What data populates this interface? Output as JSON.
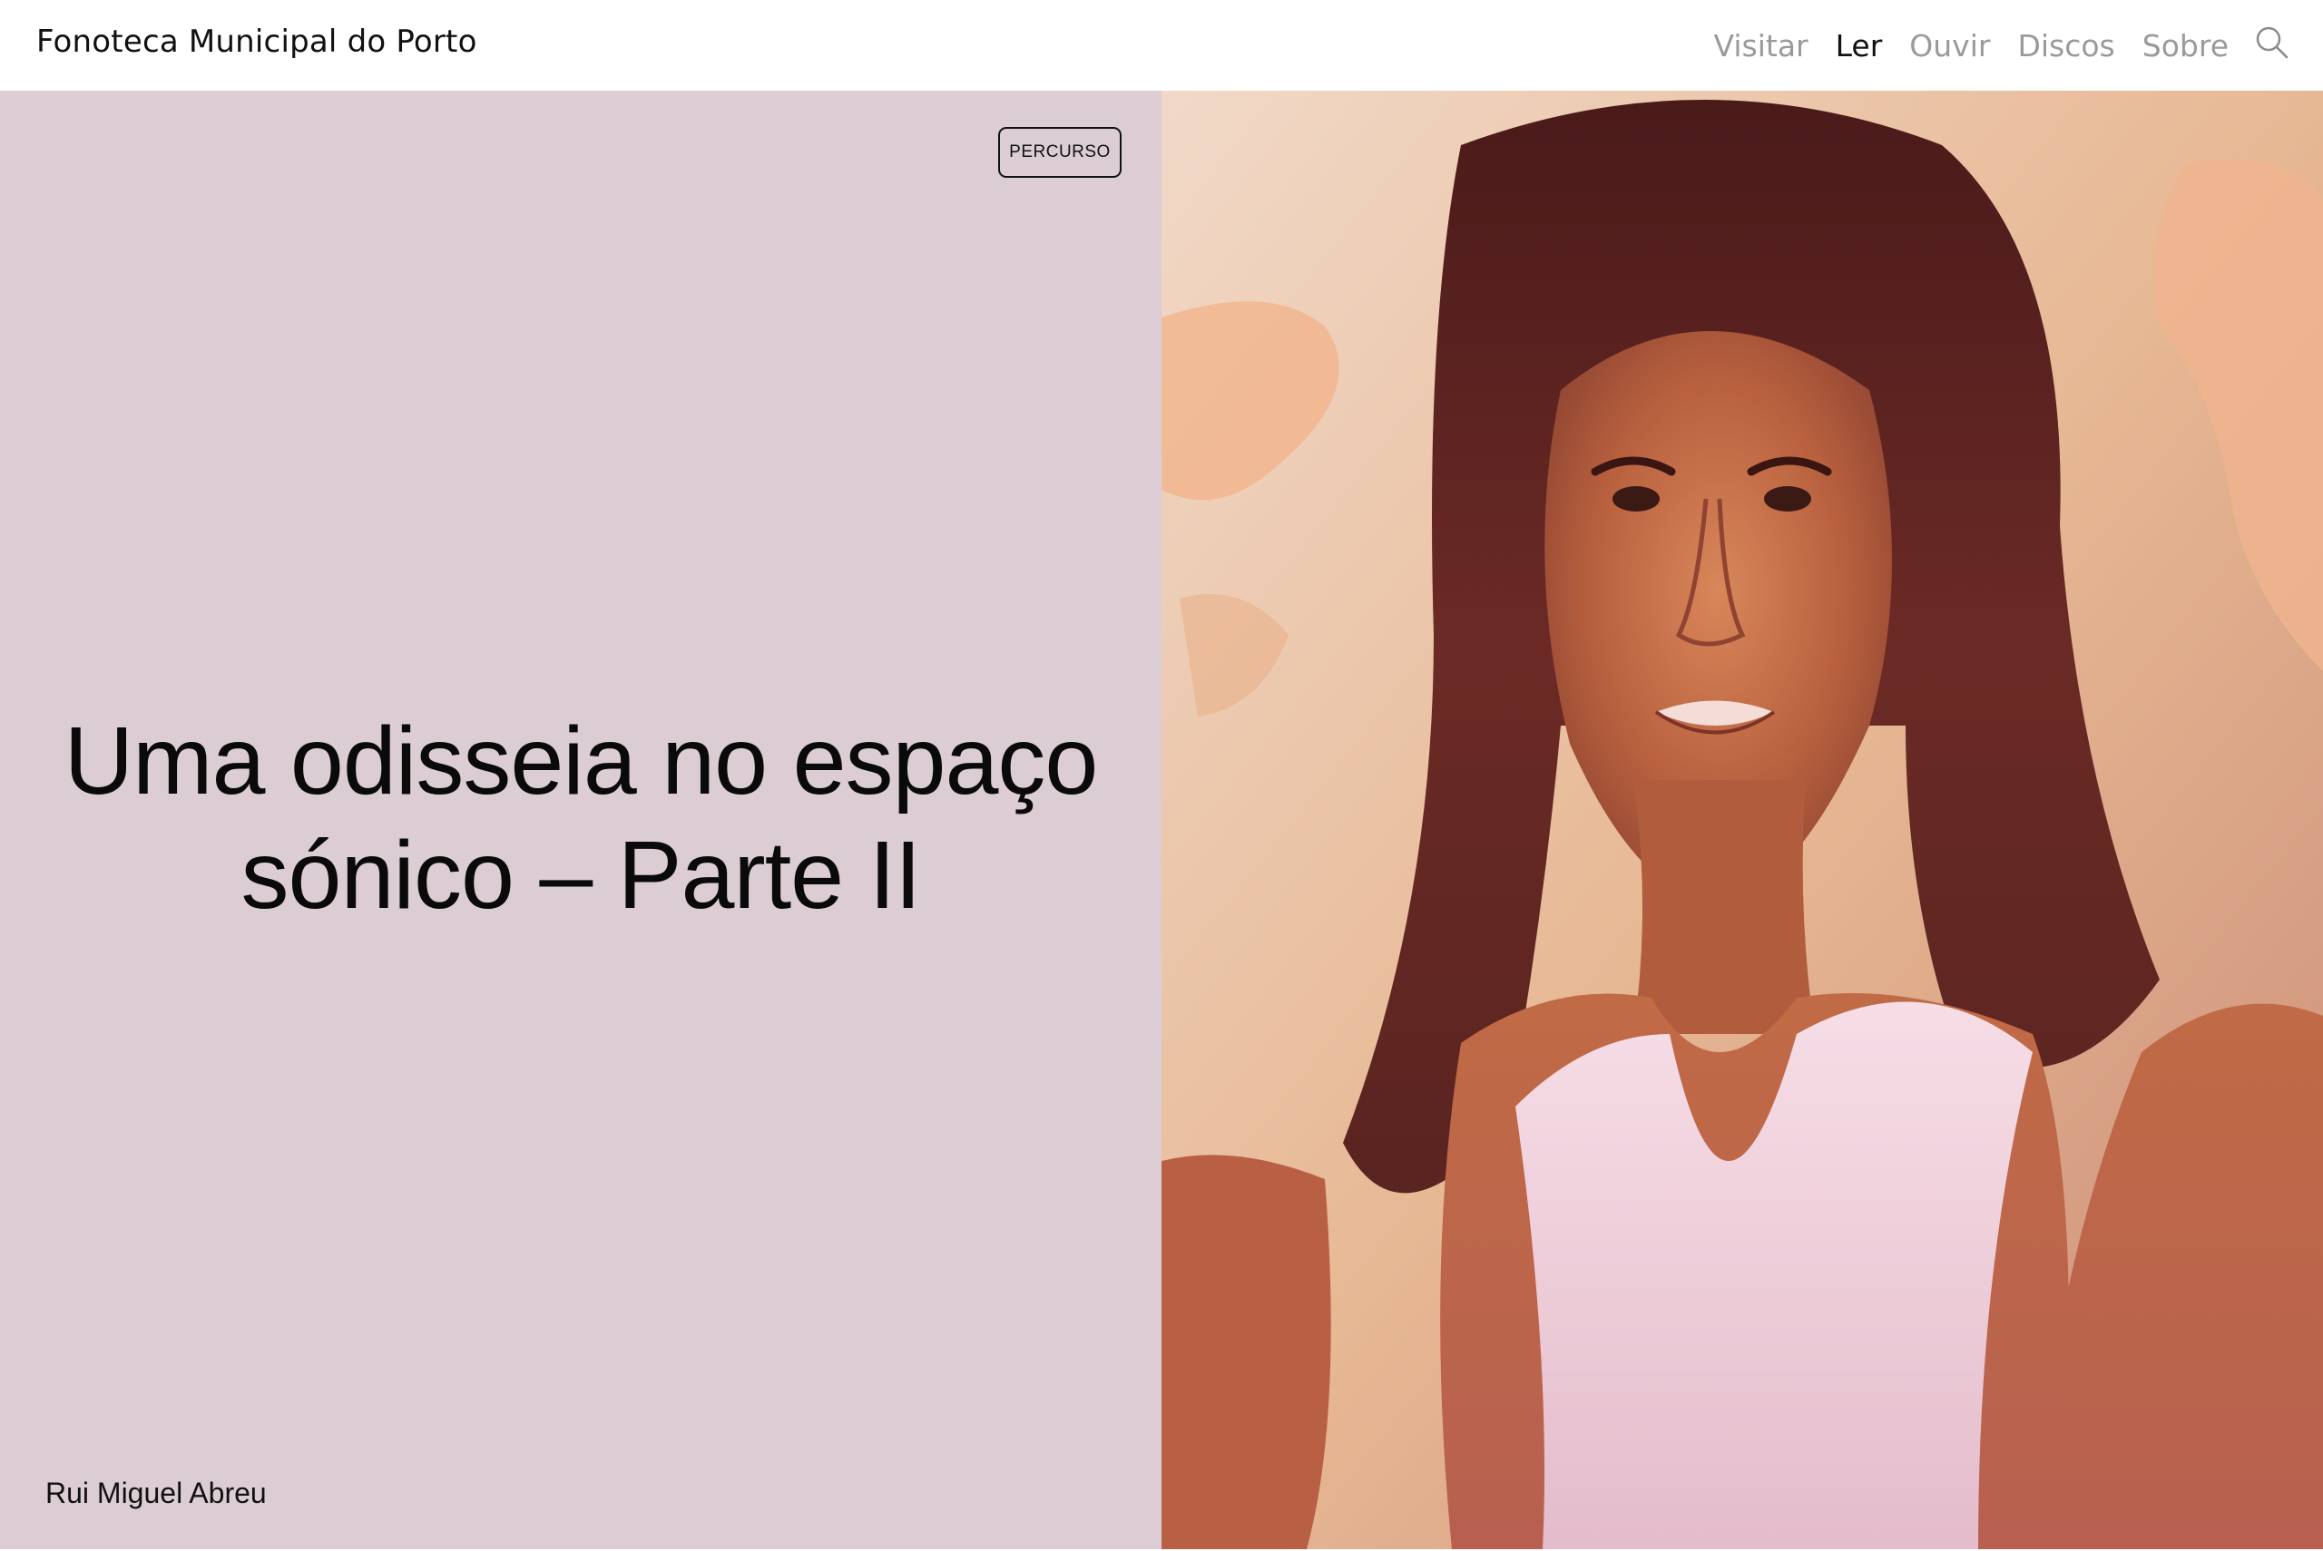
{
  "site": {
    "title": "Fonoteca Municipal do Porto"
  },
  "nav": {
    "items": [
      {
        "label": "Visitar",
        "active": false
      },
      {
        "label": "Ler",
        "active": true
      },
      {
        "label": "Ouvir",
        "active": false
      },
      {
        "label": "Discos",
        "active": false
      },
      {
        "label": "Sobre",
        "active": false
      }
    ],
    "search_icon": "search-icon"
  },
  "article": {
    "tag": "PERCURSO",
    "title_line1": "Uma odisseia no espaço",
    "title_line2": "sónico – Parte II",
    "author": "Rui Miguel Abreu"
  },
  "colors": {
    "panel_bg": "#dccdd4",
    "nav_inactive": "#9a9a9a",
    "nav_active": "#111111"
  }
}
